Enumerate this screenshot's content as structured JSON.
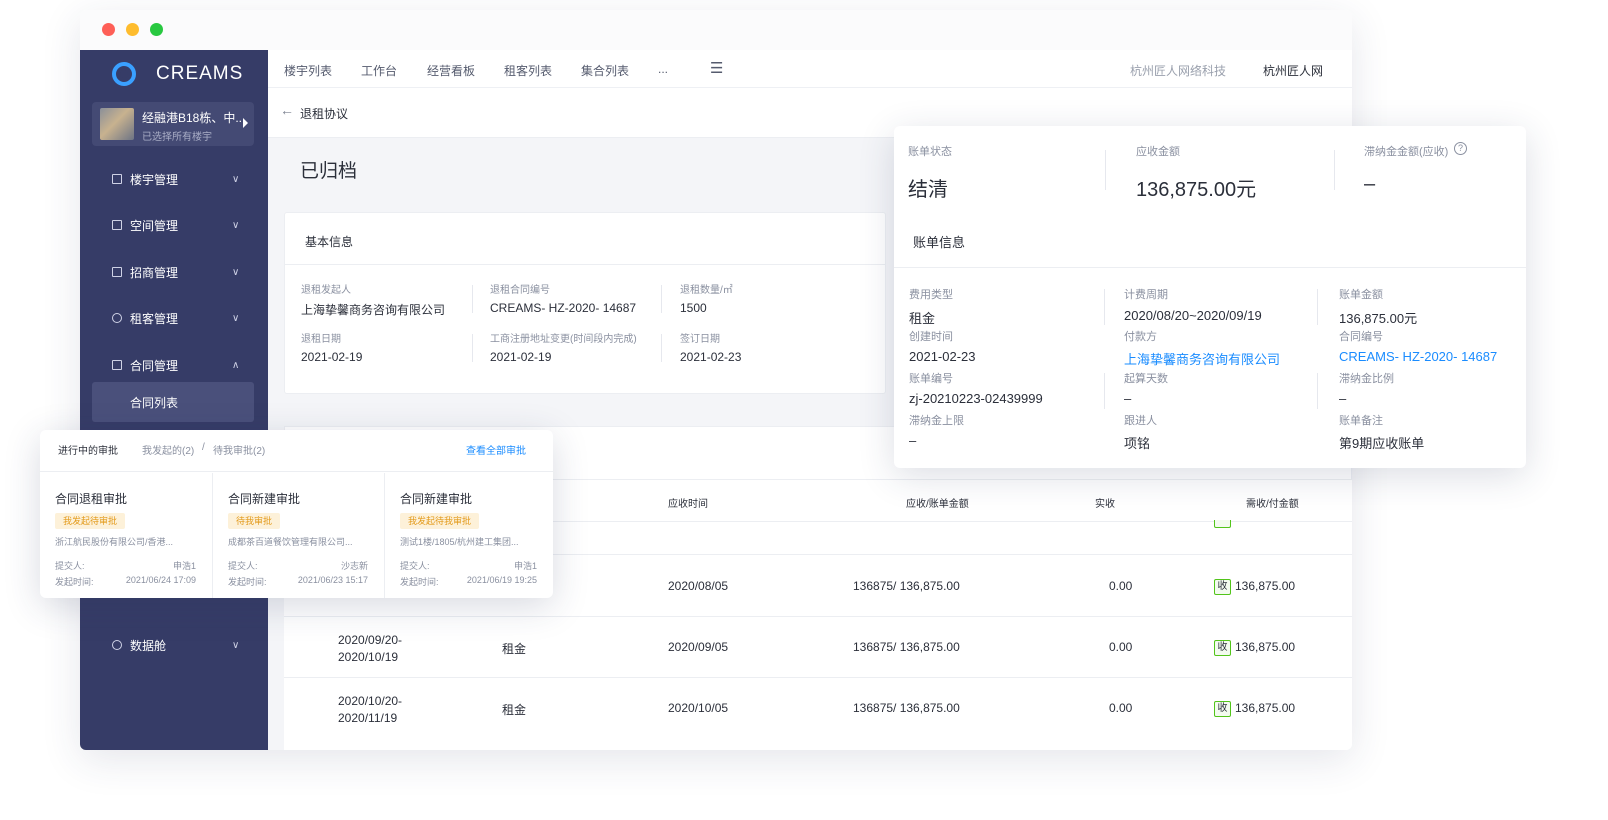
{
  "window": {
    "controls": [
      "close",
      "minimize",
      "maximize"
    ]
  },
  "sidebar": {
    "logo_text": "CREAMS",
    "building": {
      "name": "经融港B18栋、中...",
      "sub": "已选择所有楼宇"
    },
    "items": [
      {
        "label": "楼宇管理",
        "icon": "building-icon"
      },
      {
        "label": "空间管理",
        "icon": "space-icon"
      },
      {
        "label": "招商管理",
        "icon": "invest-icon"
      },
      {
        "label": "租客管理",
        "icon": "tenant-icon"
      },
      {
        "label": "合同管理",
        "icon": "contract-icon"
      }
    ],
    "sub_item": "合同列表",
    "bottom_item": {
      "label": "数据舱",
      "icon": "dashboard-icon"
    }
  },
  "topnav": {
    "tabs": [
      "楼宇列表",
      "工作台",
      "经营看板",
      "租客列表",
      "集合列表",
      "..."
    ],
    "company_a": "杭州匠人网络科技",
    "company_b": "杭州匠人网"
  },
  "page": {
    "breadcrumb": "退租协议",
    "status_title": "已归档"
  },
  "basic_info": {
    "title": "基本信息",
    "fields": [
      {
        "label": "退租发起人",
        "value": "上海挚馨商务咨询有限公司"
      },
      {
        "label": "退租合同编号",
        "value": "CREAMS- HZ-2020- 14687"
      },
      {
        "label": "退租数量/㎡",
        "value": "1500"
      },
      {
        "label": "退租日期",
        "value": "2021-02-19"
      },
      {
        "label": "工商注册地址变更(时间段内完成)",
        "value": "2021-02-19"
      },
      {
        "label": "签订日期",
        "value": "2021-02-23"
      }
    ]
  },
  "bill_table": {
    "headers": [
      "应收时间",
      "应收/账单金额",
      "实收",
      "需收/付金额"
    ],
    "rows": [
      {
        "period": "",
        "type": "",
        "due": "2020/08/05",
        "amount": "136875/ 136,875.00",
        "received": "0.00",
        "badge": "收",
        "net": "136,875.00"
      },
      {
        "period": "2020/09/20-\n2020/10/19",
        "type": "租金",
        "due": "2020/09/05",
        "amount": "136875/ 136,875.00",
        "received": "0.00",
        "badge": "收",
        "net": "136,875.00"
      },
      {
        "period": "2020/10/20-\n2020/11/19",
        "type": "租金",
        "due": "2020/10/05",
        "amount": "136875/ 136,875.00",
        "received": "0.00",
        "badge": "收",
        "net": "136,875.00"
      }
    ]
  },
  "bill_card": {
    "status_label": "账单状态",
    "status_value": "结清",
    "receivable_label": "应收金额",
    "receivable_value": "136,875.00元",
    "late_label": "滞纳金金额(应收)",
    "late_value": "–",
    "section_title": "账单信息",
    "items": [
      {
        "label": "费用类型",
        "value": "租金"
      },
      {
        "label": "计费周期",
        "value": "2020/08/20~2020/09/19"
      },
      {
        "label": "账单金额",
        "value": "136,875.00元"
      },
      {
        "label": "创建时间",
        "value": "2021-02-23"
      },
      {
        "label": "付款方",
        "value": "上海挚馨商务咨询有限公司"
      },
      {
        "label": "合同编号",
        "value": "CREAMS- HZ-2020- 14687"
      },
      {
        "label": "账单编号",
        "value": "zj-20210223-02439999"
      },
      {
        "label": "起算天数",
        "value": "–"
      },
      {
        "label": "滞纳金比例",
        "value": "–"
      },
      {
        "label": "滞纳金上限",
        "value": "–"
      },
      {
        "label": "跟进人",
        "value": "项铭"
      },
      {
        "label": "账单备注",
        "value": "第9期应收账单"
      }
    ]
  },
  "approval": {
    "title": "进行中的审批",
    "mine": "我发起的(2)",
    "slash": "/",
    "waiting": "待我审批(2)",
    "view_all": "查看全部审批",
    "submitter_label": "提交人:",
    "time_label": "发起时间:",
    "cards": [
      {
        "name": "合同退租审批",
        "tag": "我发起待审批",
        "company": "浙江航民股份有限公司/香港...",
        "submitter": "申浩1",
        "time": "2021/06/24 17:09"
      },
      {
        "name": "合同新建审批",
        "tag": "待我审批",
        "company": "成都茶百道餐饮管理有限公司...",
        "submitter": "沙志新",
        "time": "2021/06/23 15:17"
      },
      {
        "name": "合同新建审批",
        "tag": "我发起待我审批",
        "company": "测试1楼/1805/杭州建工集团...",
        "submitter": "申浩1",
        "time": "2021/06/19 19:25"
      }
    ]
  }
}
